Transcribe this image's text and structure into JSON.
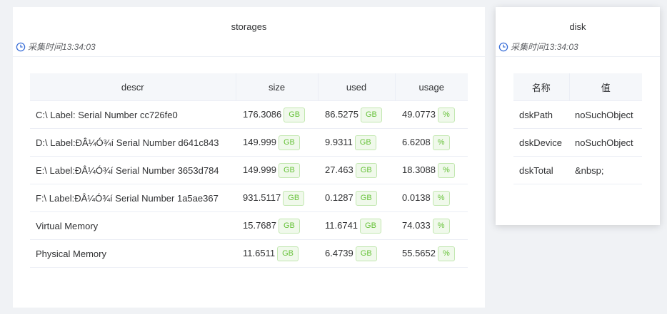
{
  "storages": {
    "title": "storages",
    "collect_time": "采集时间13:34:03",
    "columns": [
      "descr",
      "size",
      "used",
      "usage"
    ],
    "rows": [
      {
        "descr": "C:\\ Label: Serial Number cc726fe0",
        "size": "176.3086",
        "size_unit": "GB",
        "used": "86.5275",
        "used_unit": "GB",
        "usage": "49.0773",
        "usage_unit": "%"
      },
      {
        "descr": "D:\\ Label:ÐÂ¼Ó¾í Serial Number d641c843",
        "size": "149.999",
        "size_unit": "GB",
        "used": "9.9311",
        "used_unit": "GB",
        "usage": "6.6208",
        "usage_unit": "%"
      },
      {
        "descr": "E:\\ Label:ÐÂ¼Ó¾í Serial Number 3653d784",
        "size": "149.999",
        "size_unit": "GB",
        "used": "27.463",
        "used_unit": "GB",
        "usage": "18.3088",
        "usage_unit": "%"
      },
      {
        "descr": "F:\\ Label:ÐÂ¼Ó¾í Serial Number 1a5ae367",
        "size": "931.5117",
        "size_unit": "GB",
        "used": "0.1287",
        "used_unit": "GB",
        "usage": "0.0138",
        "usage_unit": "%"
      },
      {
        "descr": "Virtual Memory",
        "size": "15.7687",
        "size_unit": "GB",
        "used": "11.6741",
        "used_unit": "GB",
        "usage": "74.033",
        "usage_unit": "%"
      },
      {
        "descr": "Physical Memory",
        "size": "11.6511",
        "size_unit": "GB",
        "used": "6.4739",
        "used_unit": "GB",
        "usage": "55.5652",
        "usage_unit": "%"
      }
    ]
  },
  "disk": {
    "title": "disk",
    "collect_time": "采集时间13:34:03",
    "columns": [
      "名称",
      "值"
    ],
    "rows": [
      {
        "name": "dskPath",
        "value": "noSuchObject"
      },
      {
        "name": "dskDevice",
        "value": "noSuchObject"
      },
      {
        "name": "dskTotal",
        "value": "&nbsp;"
      }
    ]
  },
  "colors": {
    "tag_text": "#67c23a",
    "tag_bg": "#f0f9eb",
    "tag_border": "#c2e7b0",
    "accent_icon": "#3a6fd8"
  },
  "icons": {
    "collect_time": "clock-icon"
  }
}
